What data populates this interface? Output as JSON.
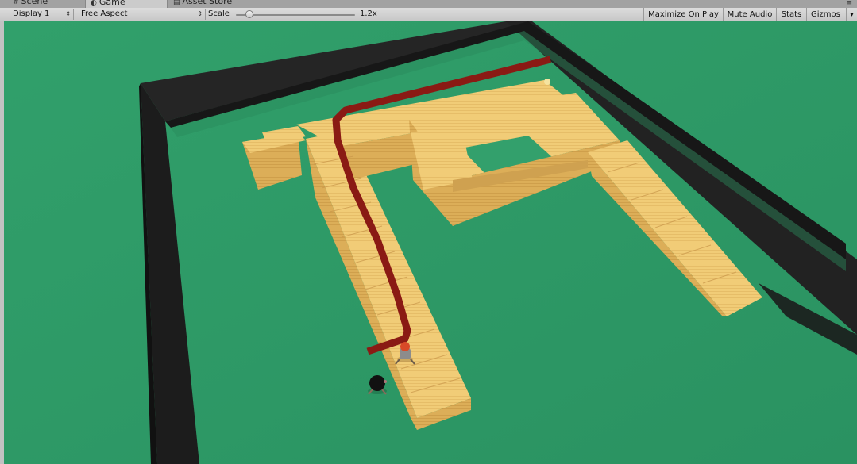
{
  "tabs": {
    "scene": "Scene",
    "game": "Game",
    "asset_store": "Asset Store"
  },
  "toolbar": {
    "display": "Display 1",
    "aspect": "Free Aspect",
    "scale_label": "Scale",
    "scale_value": "1.2x",
    "scale_level": 0.1,
    "maximize_on_play": "Maximize On Play",
    "mute_audio": "Mute Audio",
    "stats": "Stats",
    "gizmos": "Gizmos"
  },
  "scene": {
    "colors": {
      "ground": "#33a06c",
      "wall_top": "#262626",
      "wall_side": "#161616",
      "path_block_top": "#f1cc77",
      "path_block_side": "#d8ac55",
      "enemy_route": "#8a1a14",
      "player_character": "#d84a28",
      "enemy_character": "#111111"
    },
    "objects": [
      "arena-wall",
      "block-path",
      "enemy-route",
      "player-character",
      "enemy-character",
      "goal-marker"
    ]
  }
}
